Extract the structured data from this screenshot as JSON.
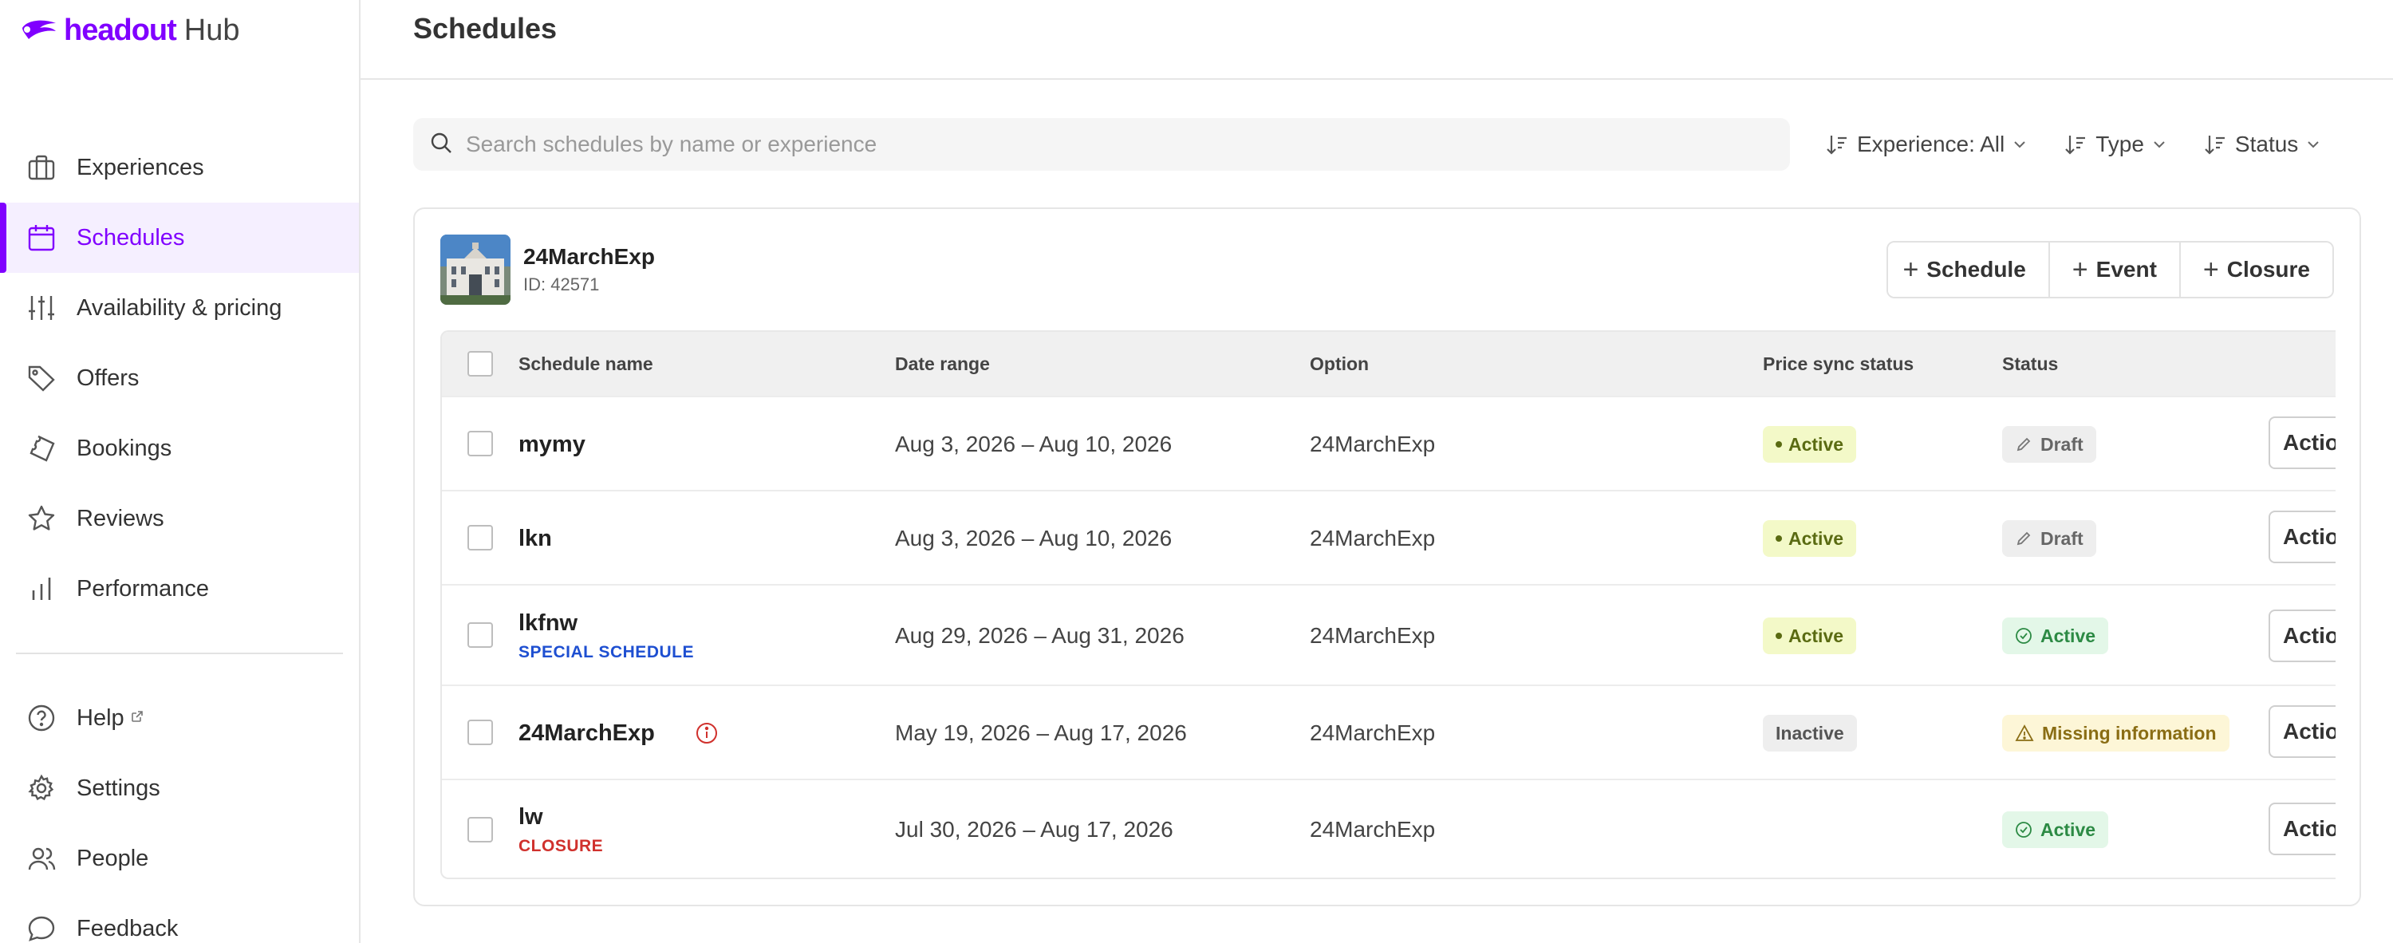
{
  "brand": {
    "name": "headout",
    "suffix": "Hub",
    "color": "#8000ff"
  },
  "sidebar": {
    "items": [
      {
        "label": "Experiences",
        "icon": "briefcase-icon"
      },
      {
        "label": "Schedules",
        "icon": "calendar-icon",
        "active": true
      },
      {
        "label": "Availability & pricing",
        "icon": "sliders-icon"
      },
      {
        "label": "Offers",
        "icon": "tag-icon"
      },
      {
        "label": "Bookings",
        "icon": "ticket-icon"
      },
      {
        "label": "Reviews",
        "icon": "star-icon"
      },
      {
        "label": "Performance",
        "icon": "bar-chart-icon"
      }
    ],
    "bottom_items": [
      {
        "label": "Help",
        "icon": "help-circle-icon",
        "external": true
      },
      {
        "label": "Settings",
        "icon": "gear-icon"
      },
      {
        "label": "People",
        "icon": "people-icon"
      },
      {
        "label": "Feedback",
        "icon": "chat-bubble-icon"
      }
    ]
  },
  "header": {
    "title": "Schedules"
  },
  "filters": {
    "search_placeholder": "Search schedules by name or experience",
    "experience": "Experience: All",
    "type": "Type",
    "status": "Status"
  },
  "experience": {
    "name": "24MarchExp",
    "id_label": "ID: 42571",
    "actions": {
      "schedule": "Schedule",
      "event": "Event",
      "closure": "Closure"
    }
  },
  "table": {
    "columns": {
      "name": "Schedule name",
      "date": "Date range",
      "option": "Option",
      "sync": "Price sync status",
      "status": "Status"
    },
    "action_label": "Actions",
    "rows": [
      {
        "name": "mymy",
        "tag": "",
        "date": "Aug 3, 2026 – Aug 10, 2026",
        "option": "24MarchExp",
        "sync": "Active",
        "status": "Draft"
      },
      {
        "name": "lkn",
        "tag": "",
        "date": "Aug 3, 2026 – Aug 10, 2026",
        "option": "24MarchExp",
        "sync": "Active",
        "status": "Draft"
      },
      {
        "name": "lkfnw",
        "tag": "SPECIAL SCHEDULE",
        "date": "Aug 29, 2026 – Aug 31, 2026",
        "option": "24MarchExp",
        "sync": "Active",
        "status": "Active"
      },
      {
        "name": "24MarchExp",
        "tag": "",
        "date": "May 19, 2026 – Aug 17, 2026",
        "option": "24MarchExp",
        "sync": "Inactive",
        "status": "Missing information"
      },
      {
        "name": "lw",
        "tag": "CLOSURE",
        "date": "Jul 30, 2026 – Aug 17, 2026",
        "option": "24MarchExp",
        "sync": "",
        "status": "Active"
      }
    ]
  },
  "colors": {
    "special_tag": "#1e4fd1",
    "closure_tag": "#d0312d",
    "info_icon": "#d0312d"
  }
}
